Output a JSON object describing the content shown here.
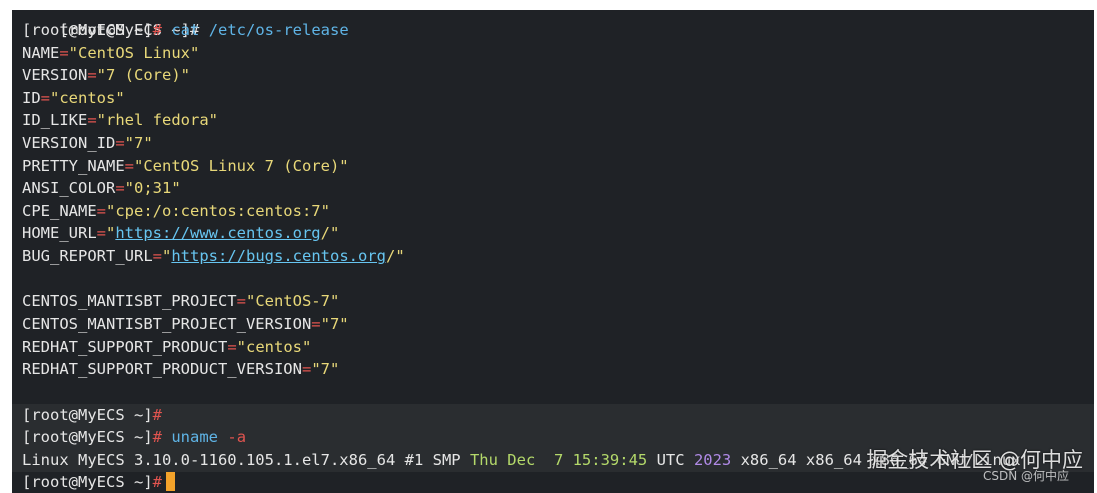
{
  "top_partial": "[root@MyECS ~]#",
  "prompt": "[root@MyECS ~]",
  "hash": "#",
  "cmd1": {
    "bin": "cat",
    "arg": "/etc/os-release"
  },
  "os_release": [
    {
      "key": "NAME",
      "value": "\"CentOS Linux\""
    },
    {
      "key": "VERSION",
      "value": "\"7 (Core)\""
    },
    {
      "key": "ID",
      "value": "\"centos\""
    },
    {
      "key": "ID_LIKE",
      "value": "\"rhel fedora\""
    },
    {
      "key": "VERSION_ID",
      "value": "\"7\""
    },
    {
      "key": "PRETTY_NAME",
      "value": "\"CentOS Linux 7 (Core)\""
    },
    {
      "key": "ANSI_COLOR",
      "value": "\"0;31\""
    },
    {
      "key": "CPE_NAME",
      "value": "\"cpe:/o:centos:centos:7\""
    }
  ],
  "home_url": {
    "key": "HOME_URL",
    "q1": "\"",
    "url": "https://www.centos.org",
    "q2": "/\""
  },
  "bug_url": {
    "key": "BUG_REPORT_URL",
    "q1": "\"",
    "url": "https://bugs.centos.org",
    "q2": "/\""
  },
  "os_release2": [
    {
      "key": "CENTOS_MANTISBT_PROJECT",
      "value": "\"CentOS-7\""
    },
    {
      "key": "CENTOS_MANTISBT_PROJECT_VERSION",
      "value": "\"7\""
    },
    {
      "key": "REDHAT_SUPPORT_PRODUCT",
      "value": "\"centos\""
    },
    {
      "key": "REDHAT_SUPPORT_PRODUCT_VERSION",
      "value": "\"7\""
    }
  ],
  "cmd2": {
    "bin": "uname",
    "flag": "-a"
  },
  "uname_output": {
    "part1": "Linux MyECS 3.10.0-1160.105.1.el7.x86_64 ",
    "build": "#1",
    "smp": " SMP ",
    "date": "Thu Dec  7 15:39:45",
    "utc": " UTC ",
    "year": "2023",
    "rest": " x86_64 x86_64 x86_64 GNU/Linux"
  },
  "watermark": "掘金技术社区 @何中应",
  "watermark_small": "CSDN @何中应",
  "colors": {
    "background": "#1f2226",
    "hash": "#e0544f",
    "command": "#5fb4e6",
    "string": "#e8d879",
    "url": "#67c5f0",
    "cursor": "#f3a22a"
  }
}
